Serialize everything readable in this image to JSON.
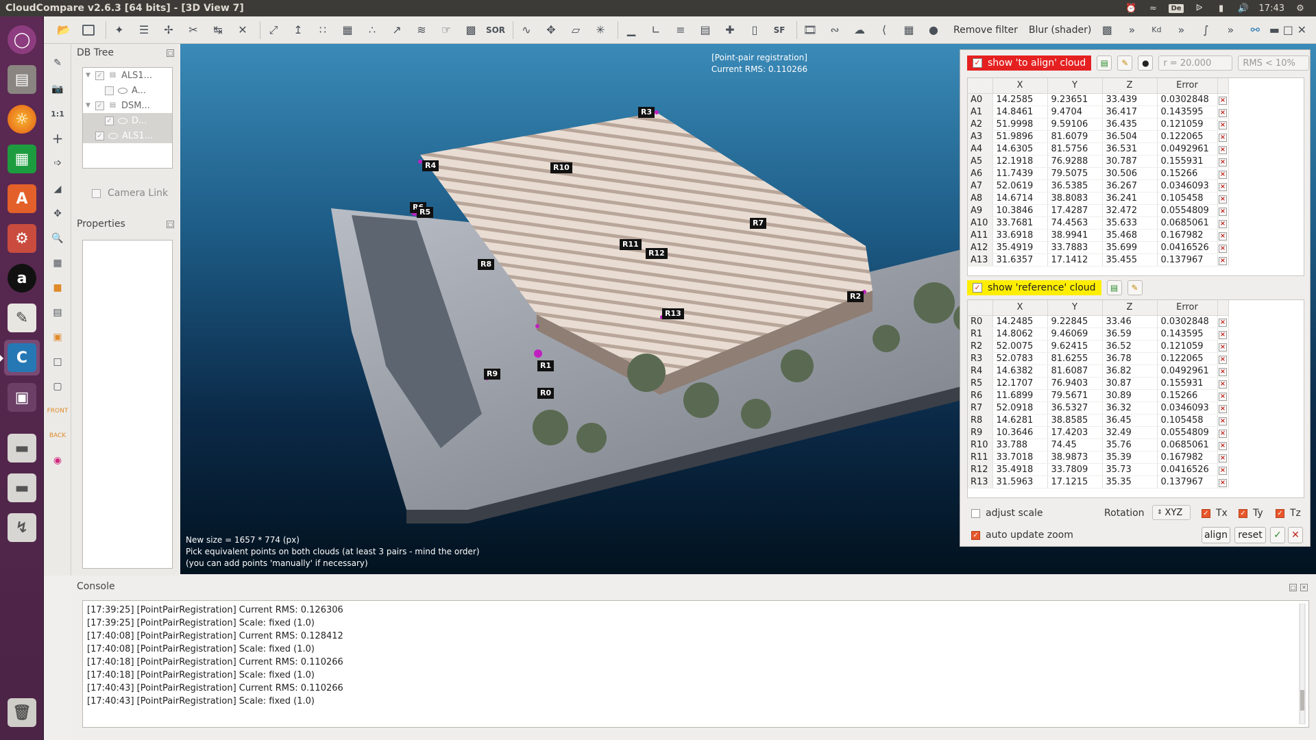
{
  "window": {
    "title": "CloudCompare v2.6.3 [64 bits] - [3D View 7]"
  },
  "tray": {
    "keyboard": "De",
    "clock": "17:43"
  },
  "launcher": {
    "items": [
      "ubuntu-dash",
      "files",
      "firefox",
      "libreoffice-calc",
      "software-center",
      "system-settings",
      "amazon",
      "text-editor",
      "cloudcompare",
      "workspaces",
      "drive",
      "drive",
      "usb",
      "trash"
    ]
  },
  "toolbar": {
    "remove_filter": "Remove filter",
    "blur_shader": "Blur (shader)",
    "sor_label": "SOR",
    "sf_label": "SF",
    "kd_label": "Kd"
  },
  "db_tree": {
    "title": "DB Tree",
    "rows": [
      {
        "label": "ALS1...",
        "level": 0,
        "selected": false
      },
      {
        "label": "A...",
        "level": 1,
        "selected": false
      },
      {
        "label": "DSM...",
        "level": 0,
        "selected": false
      },
      {
        "label": "D...",
        "level": 1,
        "selected": true
      },
      {
        "label": "ALS1...",
        "level": 0,
        "selected": true
      }
    ],
    "camera_link": "Camera Link"
  },
  "properties": {
    "title": "Properties"
  },
  "view": {
    "header_line1": "[Point-pair registration]",
    "header_line2": "Current RMS: 0.110266",
    "footer_line1": "New size = 1657 * 774 (px)",
    "footer_line2": "Pick equivalent points on both clouds (at least 3 pairs - mind the order)",
    "footer_line3": "(you can add points 'manually' if necessary)",
    "point_labels": [
      "R3",
      "R4",
      "R10",
      "R6",
      "R5",
      "R7",
      "R11",
      "R12",
      "R8",
      "R2",
      "R13",
      "R1",
      "R9",
      "R0"
    ]
  },
  "registration": {
    "align_toggle": "show 'to align' cloud",
    "radius": "r = 20.000",
    "rms_filter": "RMS < 10%",
    "reference_toggle": "show 'reference' cloud",
    "columns": [
      "X",
      "Y",
      "Z",
      "Error"
    ],
    "align_rows": [
      [
        "A0",
        "14.2585",
        "9.23651",
        "33.439",
        "0.0302848"
      ],
      [
        "A1",
        "14.8461",
        "9.4704",
        "36.417",
        "0.143595"
      ],
      [
        "A2",
        "51.9998",
        "9.59106",
        "36.435",
        "0.121059"
      ],
      [
        "A3",
        "51.9896",
        "81.6079",
        "36.504",
        "0.122065"
      ],
      [
        "A4",
        "14.6305",
        "81.5756",
        "36.531",
        "0.0492961"
      ],
      [
        "A5",
        "12.1918",
        "76.9288",
        "30.787",
        "0.155931"
      ],
      [
        "A6",
        "11.7439",
        "79.5075",
        "30.506",
        "0.15266"
      ],
      [
        "A7",
        "52.0619",
        "36.5385",
        "36.267",
        "0.0346093"
      ],
      [
        "A8",
        "14.6714",
        "38.8083",
        "36.241",
        "0.105458"
      ],
      [
        "A9",
        "10.3846",
        "17.4287",
        "32.472",
        "0.0554809"
      ],
      [
        "A10",
        "33.7681",
        "74.4563",
        "35.633",
        "0.0685061"
      ],
      [
        "A11",
        "33.6918",
        "38.9941",
        "35.468",
        "0.167982"
      ],
      [
        "A12",
        "35.4919",
        "33.7883",
        "35.699",
        "0.0416526"
      ],
      [
        "A13",
        "31.6357",
        "17.1412",
        "35.455",
        "0.137967"
      ]
    ],
    "reference_rows": [
      [
        "R0",
        "14.2485",
        "9.22845",
        "33.46",
        "0.0302848"
      ],
      [
        "R1",
        "14.8062",
        "9.46069",
        "36.59",
        "0.143595"
      ],
      [
        "R2",
        "52.0075",
        "9.62415",
        "36.52",
        "0.121059"
      ],
      [
        "R3",
        "52.0783",
        "81.6255",
        "36.78",
        "0.122065"
      ],
      [
        "R4",
        "14.6382",
        "81.6087",
        "36.82",
        "0.0492961"
      ],
      [
        "R5",
        "12.1707",
        "76.9403",
        "30.87",
        "0.155931"
      ],
      [
        "R6",
        "11.6899",
        "79.5671",
        "30.89",
        "0.15266"
      ],
      [
        "R7",
        "52.0918",
        "36.5327",
        "36.32",
        "0.0346093"
      ],
      [
        "R8",
        "14.6281",
        "38.8585",
        "36.45",
        "0.105458"
      ],
      [
        "R9",
        "10.3646",
        "17.4203",
        "32.49",
        "0.0554809"
      ],
      [
        "R10",
        "33.788",
        "74.45",
        "35.76",
        "0.0685061"
      ],
      [
        "R11",
        "33.7018",
        "38.9873",
        "35.39",
        "0.167982"
      ],
      [
        "R12",
        "35.4918",
        "33.7809",
        "35.73",
        "0.0416526"
      ],
      [
        "R13",
        "31.5963",
        "17.1215",
        "35.35",
        "0.137967"
      ]
    ],
    "adjust_scale": "adjust scale",
    "rotation_label": "Rotation",
    "rotation_value": "XYZ",
    "tx": "Tx",
    "ty": "Ty",
    "tz": "Tz",
    "auto_update_zoom": "auto update zoom",
    "align_btn": "align",
    "reset_btn": "reset"
  },
  "console": {
    "title": "Console",
    "lines": [
      "[17:39:25] [PointPairRegistration] Current RMS: 0.126306",
      "[17:39:25] [PointPairRegistration] Scale: fixed (1.0)",
      "[17:40:08] [PointPairRegistration] Current RMS: 0.128412",
      "[17:40:08] [PointPairRegistration] Scale: fixed (1.0)",
      "[17:40:18] [PointPairRegistration] Current RMS: 0.110266",
      "[17:40:18] [PointPairRegistration] Scale: fixed (1.0)",
      "[17:40:43] [PointPairRegistration] Current RMS: 0.110266",
      "[17:40:43] [PointPairRegistration] Scale: fixed (1.0)"
    ]
  }
}
